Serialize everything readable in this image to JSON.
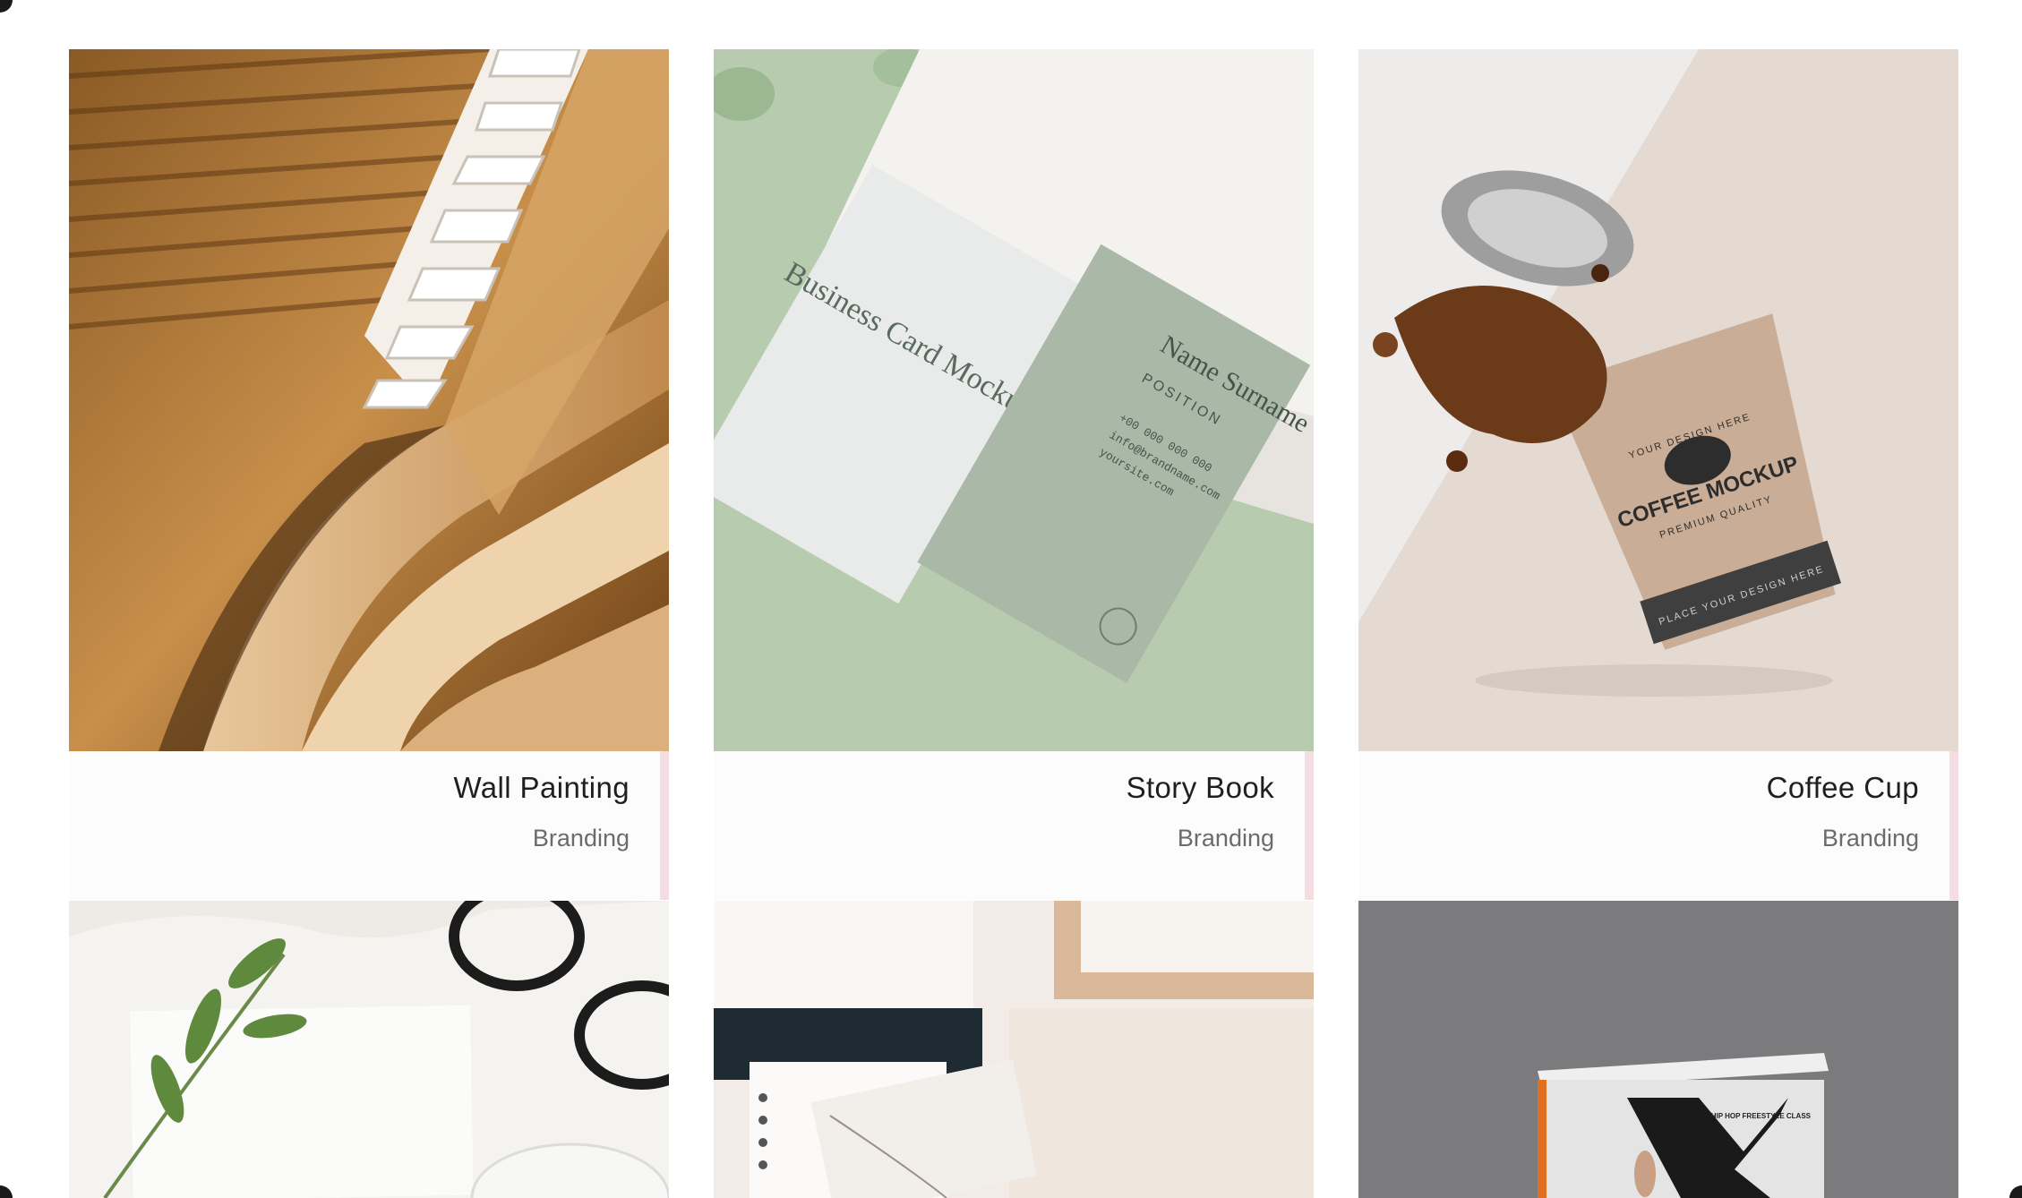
{
  "portfolio": {
    "items": [
      {
        "title": "Wall Painting",
        "category": "Branding"
      },
      {
        "title": "Story Book",
        "category": "Branding"
      },
      {
        "title": "Coffee Cup",
        "category": "Branding"
      }
    ],
    "image_labels": {
      "card_brand": "Business Card Mockup",
      "card_name": "Name Surname",
      "card_position": "POSITION",
      "card_phone": "+00 000 000 000",
      "card_email": "info@brandname.com",
      "card_site": "yoursite.com",
      "cup_brand": "COFFEE MOCKUP",
      "cup_arc_top": "YOUR DESIGN HERE",
      "cup_quality": "PREMIUM QUALITY",
      "cup_band": "PLACE YOUR DESIGN HERE",
      "book_text": "HIP HOP FREESTYLE CLASS"
    }
  }
}
